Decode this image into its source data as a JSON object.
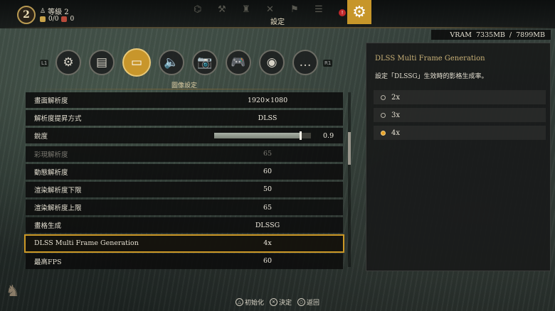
{
  "topbar": {
    "level_number": "2",
    "level_label": "等級 2",
    "stat_a": "0/0",
    "stat_b": "0",
    "page_title": "設定",
    "alert_count": "!"
  },
  "vram": {
    "label": "VRAM",
    "used": "7335MB",
    "sep": "/",
    "total": "7899MB"
  },
  "tabs": {
    "left_hint": "L1",
    "right_hint": "R1",
    "items": [
      {
        "name": "gear",
        "glyph": "⚙"
      },
      {
        "name": "controls",
        "glyph": "▤"
      },
      {
        "name": "graphics",
        "glyph": "▭"
      },
      {
        "name": "audio",
        "glyph": "🔈"
      },
      {
        "name": "camera",
        "glyph": "📷"
      },
      {
        "name": "gamepad",
        "glyph": "🎮"
      },
      {
        "name": "network",
        "glyph": "◉"
      },
      {
        "name": "chat",
        "glyph": "…"
      }
    ]
  },
  "section_title": "圖像設定",
  "settings": [
    {
      "label": "畫面解析度",
      "value": "1920×1080"
    },
    {
      "label": "解析度提昇方式",
      "value": "DLSS"
    },
    {
      "label": "銳度",
      "value": "0.9",
      "slider": 0.9
    },
    {
      "label": "彩現解析度",
      "value": "65",
      "disabled": true
    },
    {
      "label": "動態解析度",
      "value": "60"
    },
    {
      "label": "渲染解析度下限",
      "value": "50"
    },
    {
      "label": "渲染解析度上限",
      "value": "65"
    },
    {
      "label": "畫格生成",
      "value": "DLSSG"
    },
    {
      "label": "DLSS Multi Frame Generation",
      "value": "4x",
      "selected": true
    },
    {
      "label": "最高FPS",
      "value": "60"
    }
  ],
  "panel": {
    "title": "DLSS Multi Frame Generation",
    "description": "設定「DLSSG」生效時的影格生成率。",
    "options": [
      "2x",
      "3x",
      "4x"
    ],
    "selected": "4x"
  },
  "bottom": {
    "reset_icon": "△",
    "reset_label": "初始化",
    "confirm_icon": "✕",
    "confirm_label": "決定",
    "back_icon": "○",
    "back_label": "返回"
  },
  "colors": {
    "accent": "#c8962b",
    "highlight_border": "#cc9826",
    "radio_selected": "#e8a228"
  }
}
